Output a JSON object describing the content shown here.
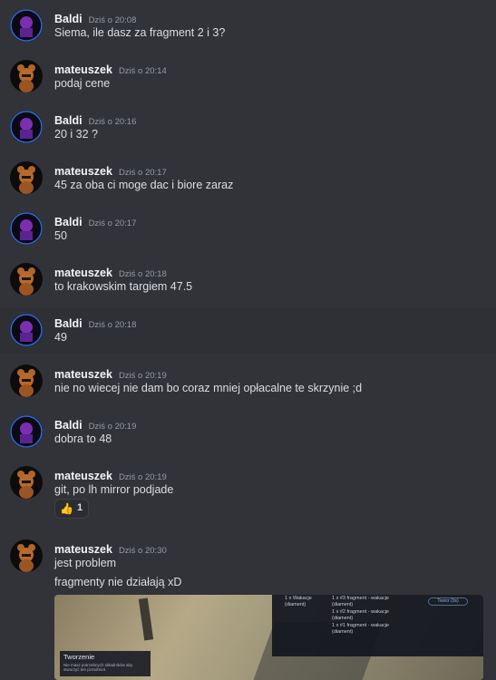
{
  "messages": [
    {
      "user": "Baldi",
      "time": "Dziś o 20:08",
      "text": "Siema, ile dasz za fragment 2 i 3?"
    },
    {
      "user": "mateuszek",
      "time": "Dziś o 20:14",
      "text": "podaj cene"
    },
    {
      "user": "Baldi",
      "time": "Dziś o 20:16",
      "text": "20 i 32 ?"
    },
    {
      "user": "mateuszek",
      "time": "Dziś o 20:17",
      "text": "45 za oba ci moge dac i biore zaraz"
    },
    {
      "user": "Baldi",
      "time": "Dziś o 20:17",
      "text": "50"
    },
    {
      "user": "mateuszek",
      "time": "Dziś o 20:18",
      "text": "to krakowskim targiem 47.5"
    },
    {
      "user": "Baldi",
      "time": "Dziś o 20:18",
      "text": "49"
    },
    {
      "user": "mateuszek",
      "time": "Dziś o 20:19",
      "text": "nie no wiecej nie dam bo coraz mniej opłacalne te skrzynie ;d"
    },
    {
      "user": "Baldi",
      "time": "Dziś o 20:19",
      "text": "dobra to 48"
    },
    {
      "user": "mateuszek",
      "time": "Dziś o 20:19",
      "text": "git, po lh mirror podjade"
    },
    {
      "user": "mateuszek",
      "time": "Dziś o 20:30",
      "text": "jest problem",
      "text2": "fragmenty nie działają xD"
    }
  ],
  "reaction": {
    "emoji": "👍",
    "count": "1"
  },
  "attachment": {
    "left_item": "1 x Wakacje",
    "left_item_sub": "(diament)",
    "lines": [
      "1 x #3 fragment - wakacje",
      "(diament)",
      "1 x #2 fragment - wakacje",
      "(diament)",
      "1 x #1 fragment - wakacje",
      "(diament)"
    ],
    "button": "Tworz (0s)",
    "window_title": "Tworzenie",
    "window_text": "Nie masz potrzebnych składników aby stworzyć ten przedmiot."
  }
}
